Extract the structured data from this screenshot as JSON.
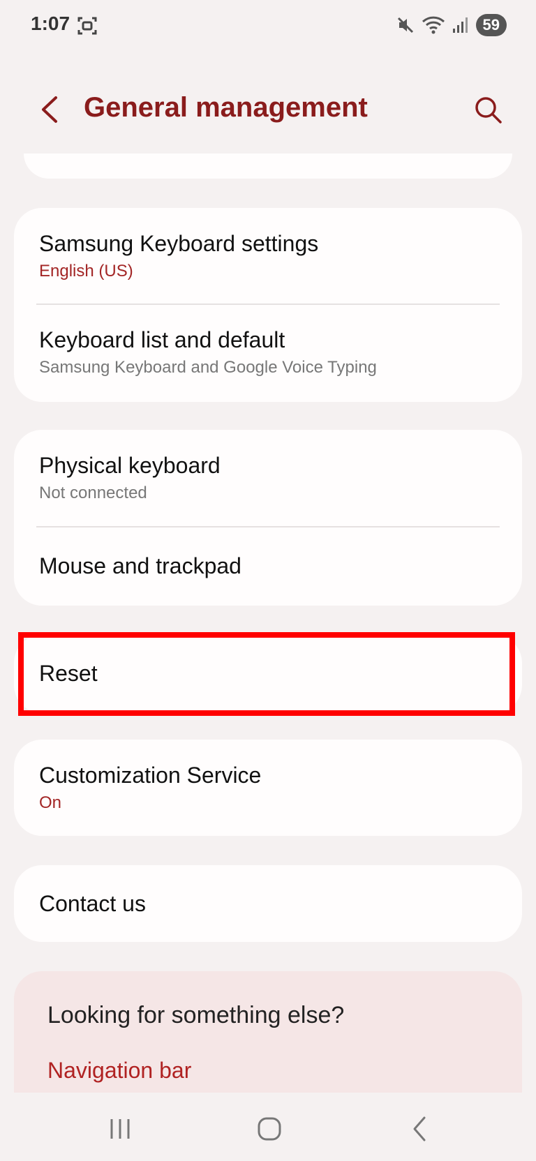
{
  "status_bar": {
    "time": "1:07",
    "battery": "59"
  },
  "header": {
    "title": "General management"
  },
  "groups": {
    "keyboard": {
      "samsung_keyboard": {
        "title": "Samsung Keyboard settings",
        "subtitle": "English (US)"
      },
      "keyboard_list": {
        "title": "Keyboard list and default",
        "subtitle": "Samsung Keyboard and Google Voice Typing"
      }
    },
    "input_devices": {
      "physical_keyboard": {
        "title": "Physical keyboard",
        "subtitle": "Not connected"
      },
      "mouse_trackpad": {
        "title": "Mouse and trackpad"
      }
    },
    "reset": {
      "title": "Reset"
    },
    "customization": {
      "title": "Customization Service",
      "subtitle": "On"
    },
    "contact": {
      "title": "Contact us"
    }
  },
  "suggestions": {
    "title": "Looking for something else?",
    "link": "Navigation bar"
  },
  "colors": {
    "accent": "#8a1c1c",
    "highlight": "#ff0000",
    "background": "#f5f1f1",
    "card": "#fffdfd"
  },
  "icons": [
    "screenshot-icon",
    "mute-icon",
    "wifi-icon",
    "signal-icon",
    "back-arrow-icon",
    "search-icon",
    "recents-icon",
    "home-icon",
    "nav-back-icon"
  ]
}
